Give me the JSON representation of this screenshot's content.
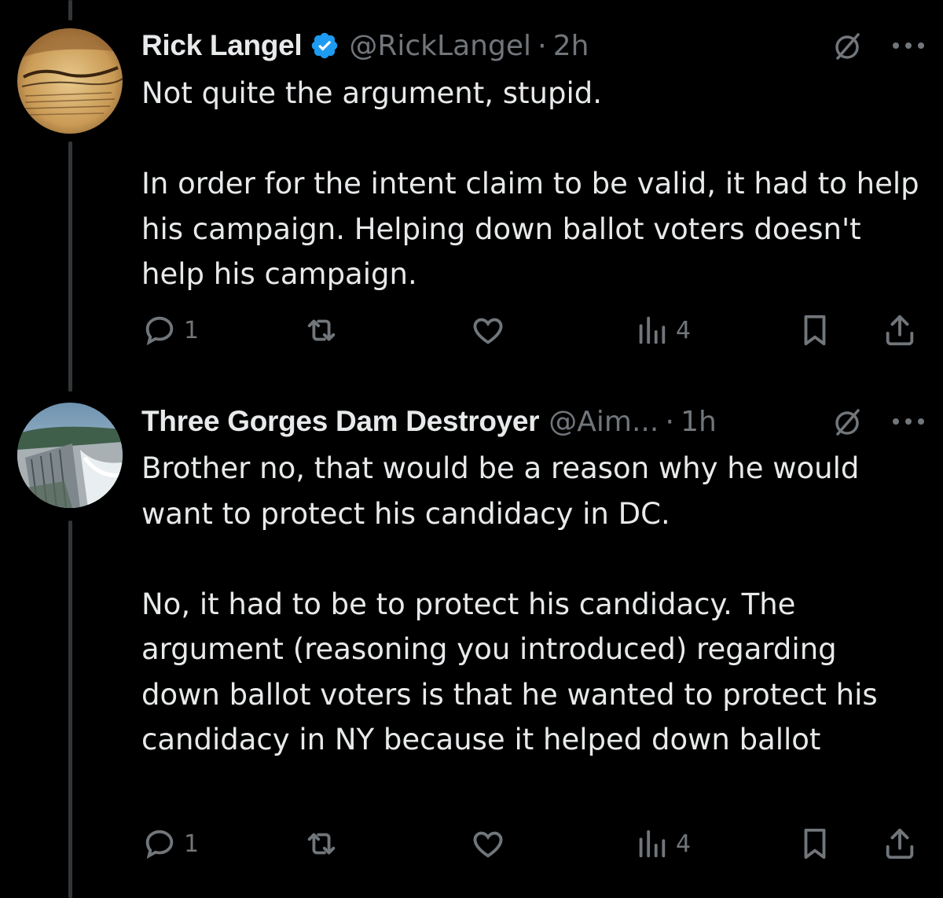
{
  "thread": {
    "tweets": [
      {
        "display_name": "Rick Langel",
        "verified": true,
        "handle": "@RickLangel",
        "separator": "·",
        "time": "2h",
        "paragraphs": [
          "Not quite the argument, stupid.",
          "In order for the intent claim to be valid, it had to help his campaign.  Helping down ballot voters doesn't help his campaign."
        ],
        "actions": {
          "replies": "1",
          "reposts": "",
          "likes": "",
          "views": "4"
        },
        "avatar_icon": "constitution-parchment-image"
      },
      {
        "display_name": "Three Gorges Dam Destroyer",
        "verified": false,
        "handle": "@Aim...",
        "separator": "·",
        "time": "1h",
        "paragraphs": [
          "Brother no, that would be a reason why he would want to protect his candidacy in DC.",
          "No, it had to be to protect his candidacy. The argument (reasoning you introduced) regarding down ballot voters is that he wanted to protect his candidacy in NY because it helped down ballot"
        ],
        "actions": {
          "replies": "1",
          "reposts": "",
          "likes": "",
          "views": "4"
        },
        "avatar_icon": "dam-photo-image"
      }
    ]
  },
  "colors": {
    "background": "#000000",
    "text": "#e7e9ea",
    "secondary": "#71767b",
    "verified": "#1d9bf0",
    "thread_line": "#333639"
  }
}
